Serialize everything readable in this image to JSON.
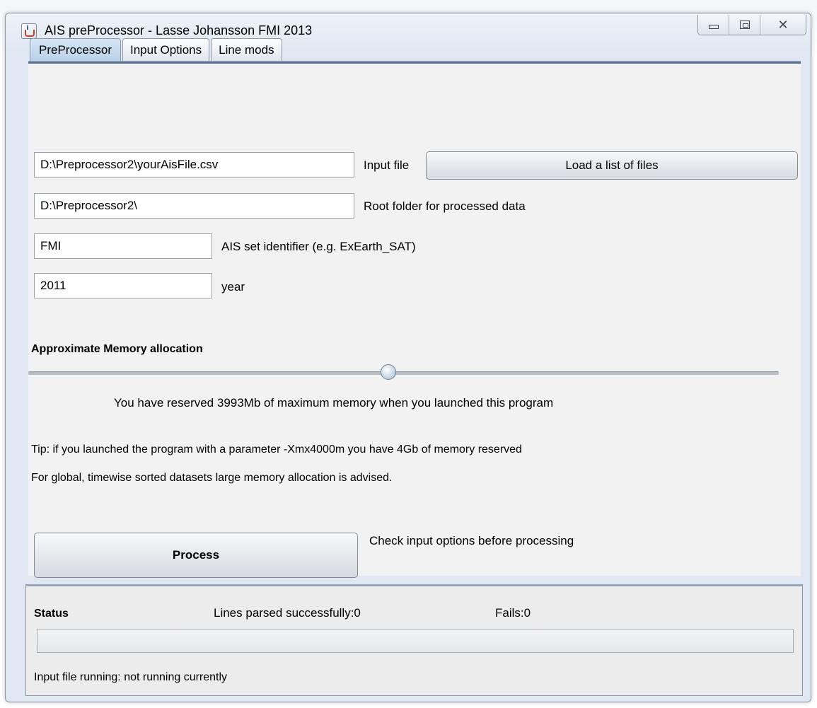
{
  "window": {
    "title": "AIS preProcessor - Lasse Johansson FMI 2013"
  },
  "tabs": [
    {
      "label": "PreProcessor",
      "active": true
    },
    {
      "label": "Input Options",
      "active": false
    },
    {
      "label": "Line mods",
      "active": false
    }
  ],
  "form": {
    "input_file": {
      "value": "D:\\Preprocessor2\\yourAisFile.csv",
      "label": "Input file"
    },
    "load_button": "Load a list of files",
    "root_folder": {
      "value": "D:\\Preprocessor2\\",
      "label": "Root folder for processed data"
    },
    "set_identifier": {
      "value": "FMI",
      "label": "AIS set identifier (e.g. ExEarth_SAT)"
    },
    "year": {
      "value": "2011",
      "label": "year"
    }
  },
  "memory": {
    "heading": "Approximate Memory allocation",
    "slider_fraction": 0.48,
    "reserved_text": "You have reserved 3993Mb of maximum memory when you launched this program",
    "tip_text": "Tip: if you launched the program with a parameter -Xmx4000m you have 4Gb of memory reserved",
    "advice_text": "For global, timewise sorted datasets large memory allocation is advised."
  },
  "process": {
    "button": "Process",
    "hint": "Check input options before processing"
  },
  "status": {
    "heading": "Status",
    "lines_parsed": "Lines parsed successfully:0",
    "fails": "Fails:0",
    "progress_fraction": 0,
    "running_text": "Input file running: not running currently"
  }
}
